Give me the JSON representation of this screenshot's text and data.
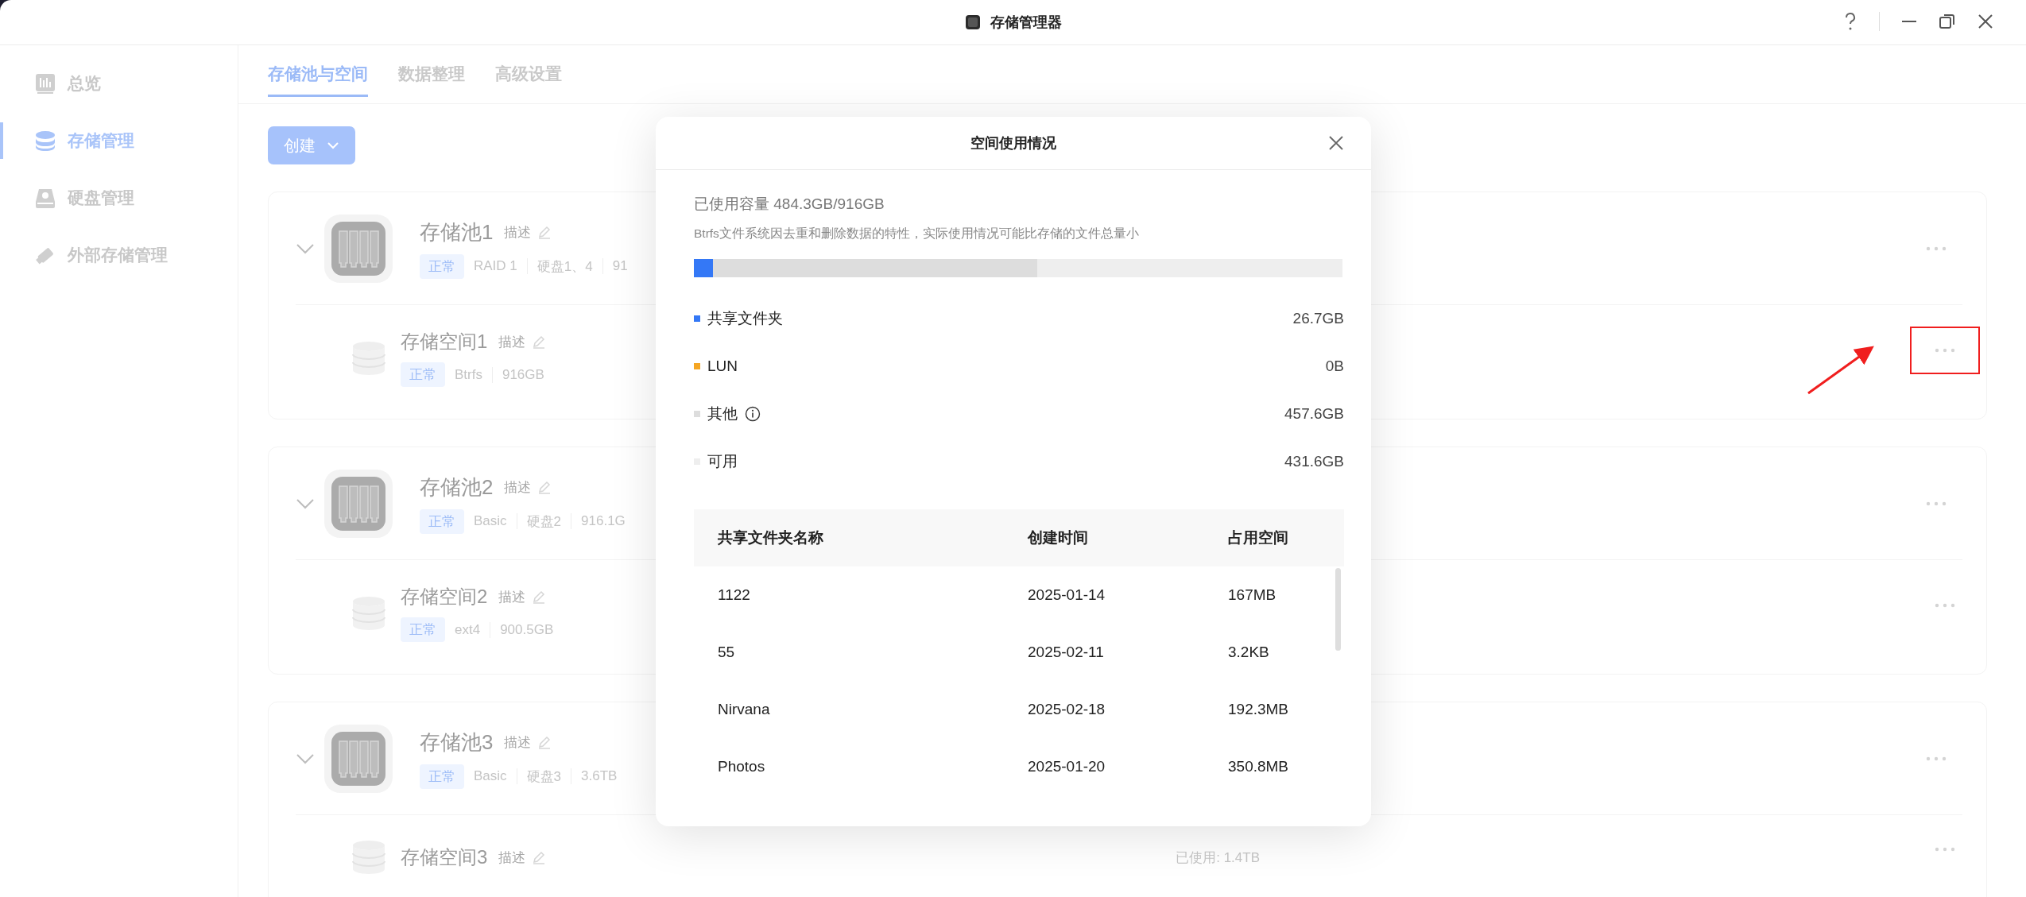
{
  "window": {
    "title": "存储管理器"
  },
  "sidebar": {
    "items": [
      {
        "label": "总览",
        "selected": false
      },
      {
        "label": "存储管理",
        "selected": true
      },
      {
        "label": "硬盘管理",
        "selected": false
      },
      {
        "label": "外部存储管理",
        "selected": false
      }
    ]
  },
  "tabs": [
    {
      "label": "存储池与空间",
      "selected": true
    },
    {
      "label": "数据整理",
      "selected": false
    },
    {
      "label": "高级设置",
      "selected": false
    }
  ],
  "create_button": {
    "label": "创建"
  },
  "pools": [
    {
      "name": "存储池1",
      "description": "描述",
      "status": "正常",
      "tags": [
        "RAID 1",
        "硬盘1、4",
        "91"
      ],
      "spaces": [
        {
          "name": "存储空间1",
          "description": "描述",
          "status": "正常",
          "tags": [
            "Btrfs",
            "916GB"
          ],
          "highlighted": true
        }
      ]
    },
    {
      "name": "存储池2",
      "description": "描述",
      "status": "正常",
      "tags": [
        "Basic",
        "硬盘2",
        "916.1G"
      ],
      "spaces": [
        {
          "name": "存储空间2",
          "description": "描述",
          "status": "正常",
          "tags": [
            "ext4",
            "900.5GB"
          ],
          "highlighted": false
        }
      ]
    },
    {
      "name": "存储池3",
      "description": "描述",
      "status": "正常",
      "tags": [
        "Basic",
        "硬盘3",
        "3.6TB"
      ],
      "spaces": [
        {
          "name": "存储空间3",
          "description": "描述",
          "usage": "已使用: 1.4TB",
          "highlighted": false
        }
      ]
    }
  ],
  "dialog": {
    "title": "空间使用情况",
    "used": "已使用容量 484.3GB/916GB",
    "note": "Btrfs文件系统因去重和删除数据的特性，实际使用情况可能比存储的文件总量小",
    "usage_bar": [
      {
        "level": 0.529,
        "color": "#dddddd"
      },
      {
        "level": 0.029,
        "color": "#3478f6"
      }
    ],
    "legend": [
      {
        "kind": "plain",
        "label": "共享文件夹",
        "value": "26.7GB",
        "color": "#3478f6"
      },
      {
        "kind": "plain",
        "label": "LUN",
        "value": "0B",
        "color": "#f5a623"
      },
      {
        "kind": "info",
        "label": "其他",
        "value": "457.6GB",
        "color": "#dddddd"
      },
      {
        "kind": "plain",
        "label": "可用",
        "value": "431.6GB",
        "color": "#eeeeee"
      }
    ],
    "table": {
      "columns": [
        "共享文件夹名称",
        "创建时间",
        "占用空间"
      ],
      "rows": [
        [
          "1122",
          "2025-01-14",
          "167MB"
        ],
        [
          "55",
          "2025-02-11",
          "3.2KB"
        ],
        [
          "Nirvana",
          "2025-02-18",
          "192.3MB"
        ],
        [
          "Photos",
          "2025-01-20",
          "350.8MB"
        ]
      ]
    }
  }
}
